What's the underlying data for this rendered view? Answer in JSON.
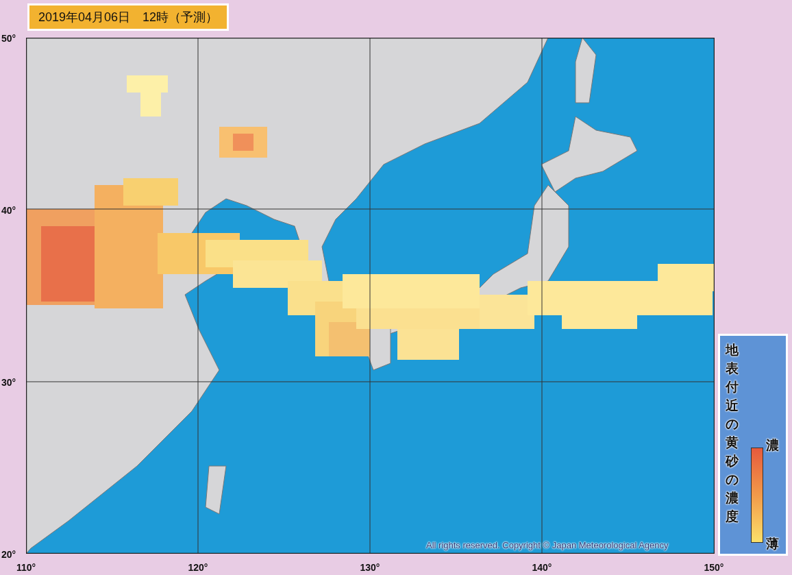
{
  "title": "2019年04月06日　12時（予測）",
  "latitude_labels": [
    "50°",
    "40°",
    "30°",
    "20°"
  ],
  "longitude_labels": [
    "110°",
    "120°",
    "130°",
    "140°",
    "150°"
  ],
  "legend": {
    "title": "地表付近の黄砂の濃度",
    "high_label": "濃",
    "low_label": "薄"
  },
  "copyright": "All rights reserved. Copyright © Japan Meteorological Agency"
}
